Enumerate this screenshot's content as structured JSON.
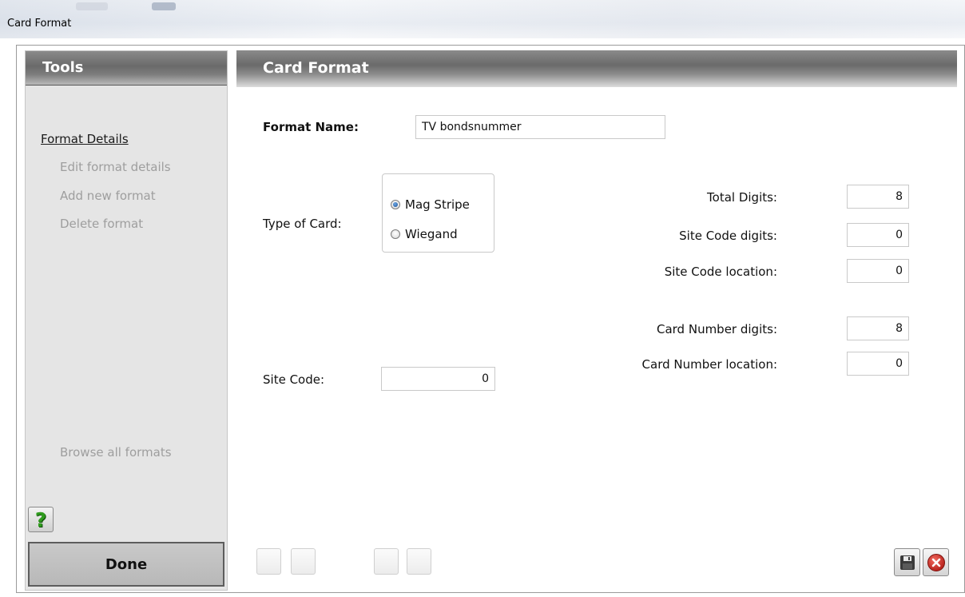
{
  "window": {
    "title": "Card Format"
  },
  "tools": {
    "header": "Tools",
    "section_label": "Format Details",
    "items": [
      "Edit format details",
      "Add new format",
      "Delete format"
    ],
    "browse_label": "Browse all formats",
    "help_label": "?",
    "done_label": "Done"
  },
  "main": {
    "header": "Card Format",
    "format_name_label": "Format Name:",
    "format_name_value": "TV bondsnummer",
    "type_of_card_label": "Type of Card:",
    "card_types": [
      "Mag Stripe",
      "Wiegand"
    ],
    "selected_card_type": "Mag Stripe",
    "site_code_label": "Site Code:",
    "site_code_value": "0",
    "fields": {
      "total_digits": {
        "label": "Total Digits:",
        "value": "8"
      },
      "site_code_digits": {
        "label": "Site Code digits:",
        "value": "0"
      },
      "site_code_location": {
        "label": "Site Code location:",
        "value": "0"
      },
      "card_number_digits": {
        "label": "Card Number digits:",
        "value": "8"
      },
      "card_number_location": {
        "label": "Card Number location:",
        "value": "0"
      }
    }
  },
  "icons": {
    "save": "save-icon",
    "cancel": "cancel-icon",
    "help": "help-icon"
  },
  "colors": {
    "header_gray": "#7a7a7a",
    "help_green": "#2f9b1d",
    "cancel_red": "#d3332a"
  }
}
